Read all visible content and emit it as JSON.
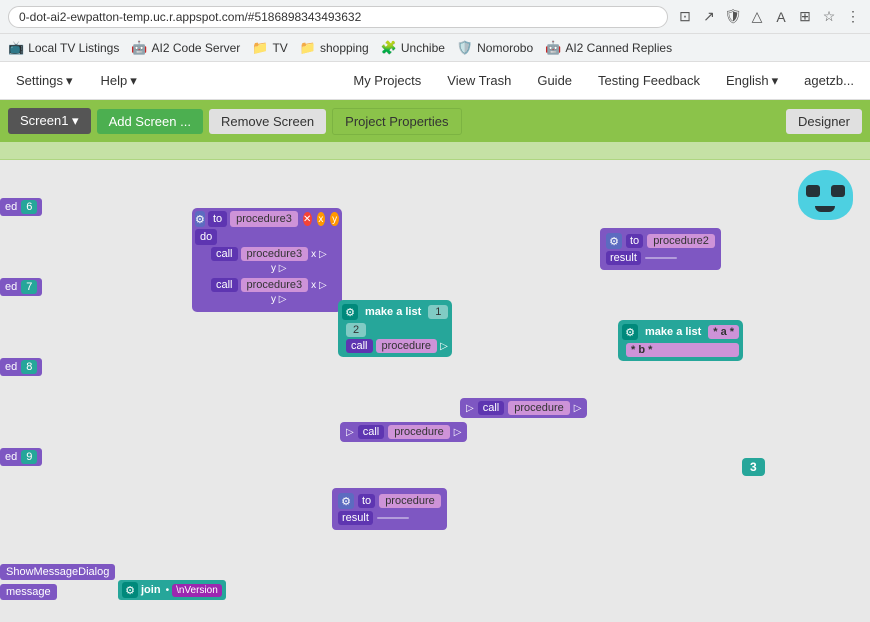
{
  "browser": {
    "url": "0-dot-ai2-ewpatton-temp.uc.r.appspot.com/#5186898343493632",
    "icons": [
      "screen-share",
      "external-link",
      "shield",
      "triangle-alert",
      "translate",
      "apps",
      "settings",
      "more"
    ]
  },
  "bookmarks": [
    {
      "label": "Local TV Listings",
      "icon": "📺"
    },
    {
      "label": "AI2 Code Server",
      "icon": "🤖"
    },
    {
      "label": "TV",
      "icon": "📁"
    },
    {
      "label": "shopping",
      "icon": "📁"
    },
    {
      "label": "Unchibe",
      "icon": "🧩"
    },
    {
      "label": "Nomorobo",
      "icon": "🛡️"
    },
    {
      "label": "AI2 Canned Replies",
      "icon": "🤖"
    }
  ],
  "nav": {
    "left": [
      {
        "label": "Settings",
        "dropdown": true
      },
      {
        "label": "Help",
        "dropdown": true
      }
    ],
    "right": [
      {
        "label": "My Projects"
      },
      {
        "label": "View Trash"
      },
      {
        "label": "Guide"
      },
      {
        "label": "Testing Feedback"
      },
      {
        "label": "English",
        "dropdown": true
      },
      {
        "label": "agetzb..."
      }
    ]
  },
  "toolbar": {
    "screen1_label": "Screen1",
    "add_screen_label": "Add Screen ...",
    "remove_screen_label": "Remove Screen",
    "project_properties_label": "Project Properties",
    "designer_label": "Designer"
  },
  "blocks": {
    "procedure3_main": {
      "to": "to",
      "name": "procedure3",
      "params": [
        "x",
        "y"
      ],
      "do_label": "do",
      "calls": [
        {
          "call": "call",
          "name": "procedure3",
          "var": "x"
        },
        {
          "call": "call",
          "name": "procedure3",
          "var": "y"
        }
      ]
    },
    "procedure2": {
      "to": "to",
      "name": "procedure2",
      "result_label": "result"
    },
    "make_list_1": {
      "label": "make a list",
      "items": [
        "1",
        "2"
      ],
      "call_label": "call",
      "call_name": "procedure"
    },
    "make_list_2": {
      "label": "make a list",
      "items": [
        "a",
        "b"
      ]
    },
    "call_procedure_1": {
      "call": "call",
      "name": "procedure"
    },
    "call_procedure_2": {
      "call": "call",
      "name": "procedure"
    },
    "num_block": {
      "value": "3"
    },
    "procedure_result": {
      "to": "to",
      "name": "procedure",
      "result": "result"
    },
    "side_blocks": [
      {
        "suffix": "ed",
        "num": "6"
      },
      {
        "suffix": "ed",
        "num": "7"
      },
      {
        "suffix": "ed",
        "num": "8"
      },
      {
        "suffix": "ed",
        "num": "9"
      }
    ],
    "bottom": {
      "show_message": "ShowMessageDialog",
      "message_label": "message",
      "join_label": "join",
      "version_label": "\\nVersion"
    }
  }
}
